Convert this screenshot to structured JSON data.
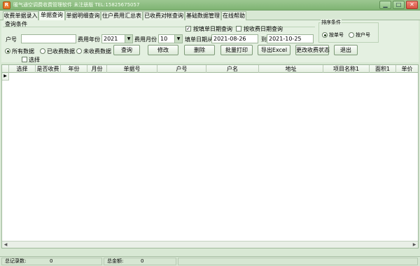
{
  "window": {
    "title": "暖气通空调费收费管理软件  未注册版  TEL:15825675057",
    "icon_char": "R",
    "minimize": "▁",
    "maximize": "□",
    "close": "✕"
  },
  "tabs": [
    "收费单据录入",
    "单据查询",
    "单据明细查询",
    "住户费用汇总表",
    "已收费对帐查询",
    "基础数据管理",
    "在线帮助"
  ],
  "active_tab": 1,
  "query": {
    "group_title": "查询条件",
    "account_label": "户号",
    "account_value": "",
    "year_label": "费用年份",
    "year_value": "2021",
    "month_label": "费用月份",
    "month_value": "10",
    "by_fill_date_label": "按填单日期查询",
    "by_fill_date_checked": true,
    "by_pay_date_label": "按收费日期查询",
    "by_pay_date_checked": false,
    "fill_date_from_label": "填单日期从",
    "date_from": "2021-08-26",
    "to_label": "到",
    "date_to": "2021-10-25",
    "filter_all": "所有数据",
    "filter_paid": "已收费数据",
    "filter_unpaid": "未收费数据",
    "filter_selected": "所有数据",
    "select_label": "选择"
  },
  "sort": {
    "title": "排序条件",
    "by_bill": "按单号",
    "by_account": "按户号",
    "selected": "按单号"
  },
  "buttons": {
    "query": "查询",
    "edit": "修改",
    "delete": "删除",
    "batch_print": "批量打印",
    "export_excel": "导出Excel",
    "change_status": "更改收费状态",
    "exit": "退出"
  },
  "grid": {
    "columns": [
      "选择",
      "是否收费",
      "年份",
      "月份",
      "单据号",
      "户号",
      "户名",
      "地址",
      "项目名称1",
      "面积1",
      "单价"
    ],
    "rows": [],
    "row_indicator": "▶"
  },
  "status": {
    "total_records_label": "总记录数:",
    "total_records_value": "0",
    "total_amount_label": "总金额:",
    "total_amount_value": "0"
  }
}
